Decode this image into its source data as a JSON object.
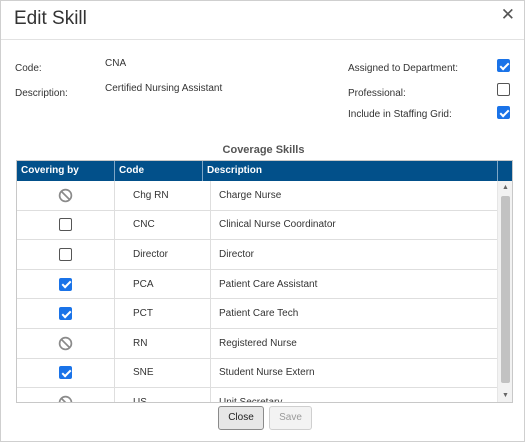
{
  "dialog": {
    "title": "Edit Skill",
    "close_glyph": "✕"
  },
  "fields": {
    "code_label": "Code:",
    "code_value": "CNA",
    "description_label": "Description:",
    "description_value": "Certified Nursing Assistant",
    "assigned_label": "Assigned to Department:",
    "assigned_checked": true,
    "professional_label": "Professional:",
    "professional_checked": false,
    "staffing_label": "Include in Staffing Grid:",
    "staffing_checked": true
  },
  "coverage": {
    "title": "Coverage Skills",
    "columns": [
      "Covering by",
      "Code",
      "Description"
    ],
    "rows": [
      {
        "state": "disabled",
        "code": "Chg RN",
        "description": "Charge Nurse"
      },
      {
        "state": "unchecked",
        "code": "CNC",
        "description": "Clinical Nurse Coordinator"
      },
      {
        "state": "unchecked",
        "code": "Director",
        "description": "Director"
      },
      {
        "state": "checked",
        "code": "PCA",
        "description": "Patient Care Assistant"
      },
      {
        "state": "checked",
        "code": "PCT",
        "description": "Patient Care Tech"
      },
      {
        "state": "disabled",
        "code": "RN",
        "description": "Registered Nurse"
      },
      {
        "state": "checked",
        "code": "SNE",
        "description": "Student Nurse Extern"
      },
      {
        "state": "disabled",
        "code": "US",
        "description": "Unit Secretary"
      }
    ]
  },
  "buttons": {
    "close": "Close",
    "save": "Save"
  },
  "colors": {
    "header_bg": "#02508a",
    "checkbox": "#1a73e8"
  },
  "icons": {
    "close": "close-icon",
    "disabled": "no-entry-icon",
    "scroll_up": "chevron-up-icon",
    "scroll_down": "chevron-down-icon"
  }
}
